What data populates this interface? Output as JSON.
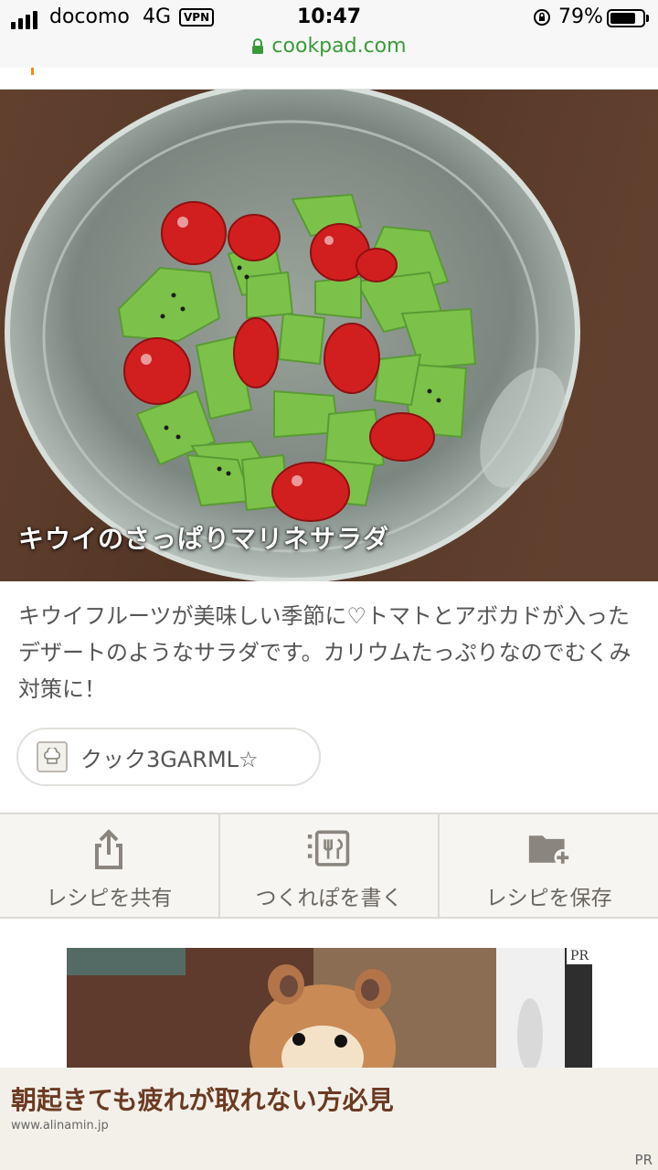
{
  "status_bar": {
    "carrier": "docomo",
    "network": "4G",
    "vpn": "VPN",
    "time": "10:47",
    "battery": "79%",
    "battery_level": 0.79
  },
  "browser": {
    "url": "cookpad.com"
  },
  "recipe": {
    "title": "キウイのさっぱりマリネサラダ",
    "description": "キウイフルーツが美味しい季節に♡トマトとアボカドが入ったデザートのようなサラダです。カリウムたっぷりなのでむくみ対策に！",
    "author": "クック3GARML☆"
  },
  "actions": [
    {
      "label": "レシピを共有",
      "icon": "share-icon"
    },
    {
      "label": "つくれぽを書く",
      "icon": "write-report-icon"
    },
    {
      "label": "レシピを保存",
      "icon": "folder-add-icon"
    }
  ],
  "ad": {
    "pr_label": "PR",
    "headline": "朝起きても疲れが取れない方必見",
    "domain": "www.alinamin.jp",
    "pr_bottom": "PR"
  }
}
